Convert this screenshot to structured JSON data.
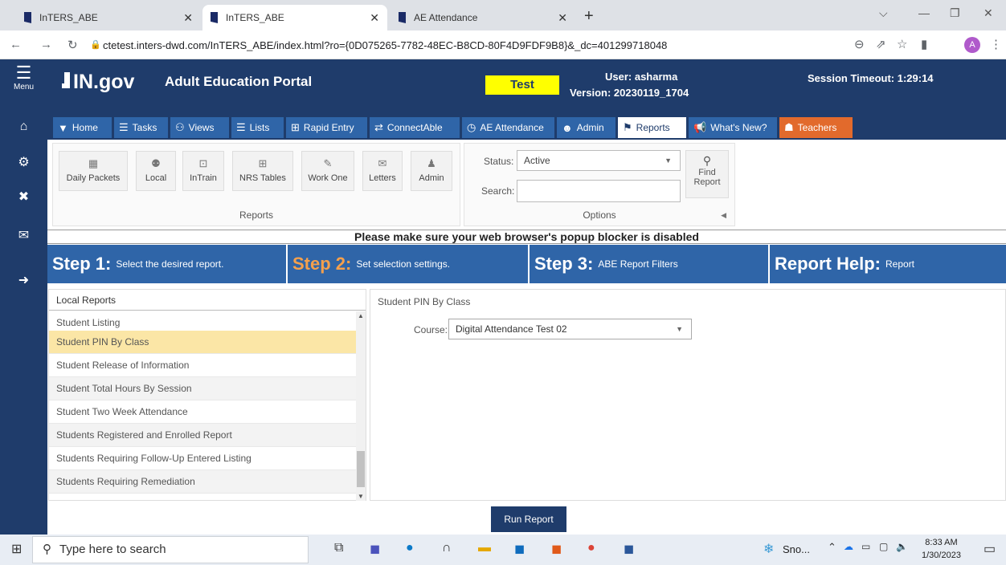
{
  "browser": {
    "tabs": [
      {
        "title": "InTERS_ABE"
      },
      {
        "title": "InTERS_ABE"
      },
      {
        "title": "AE Attendance"
      }
    ],
    "url": "ctetest.inters-dwd.com/InTERS_ABE/index.html?ro={0D075265-7782-48EC-B8CD-80F4D9FDF9B8}&_dc=401299718048",
    "profile_initial": "A"
  },
  "sidebar": {
    "menu_label": "Menu"
  },
  "header": {
    "logo": "IN.gov",
    "portal_title": "Adult Education Portal",
    "env_badge": "Test",
    "user": "User: asharma",
    "version": "Version: 20230119_1704",
    "session": "Session Timeout: 1:29:14"
  },
  "menu": [
    {
      "label": "Home",
      "icon": "funnel-icon"
    },
    {
      "label": "Tasks",
      "icon": "checklist-icon"
    },
    {
      "label": "Views",
      "icon": "binoculars-icon"
    },
    {
      "label": "Lists",
      "icon": "list-icon"
    },
    {
      "label": "Rapid Entry",
      "icon": "table-icon"
    },
    {
      "label": "ConnectAble",
      "icon": "exchange-icon"
    },
    {
      "label": "AE Attendance",
      "icon": "clock-icon"
    },
    {
      "label": "Admin",
      "icon": "users-icon"
    },
    {
      "label": "Reports",
      "icon": "flag-icon"
    },
    {
      "label": "What's New?",
      "icon": "megaphone-icon"
    },
    {
      "label": "Teachers",
      "icon": "teacher-icon"
    }
  ],
  "ribbon": {
    "reports_buttons": [
      {
        "label": "Daily Packets",
        "icon": "calendar-icon"
      },
      {
        "label": "Local",
        "icon": "group-icon"
      },
      {
        "label": "InTrain",
        "icon": "presentation-icon"
      },
      {
        "label": "NRS Tables",
        "icon": "table-icon"
      },
      {
        "label": "Work One",
        "icon": "edit-icon"
      },
      {
        "label": "Letters",
        "icon": "envelope-icon"
      },
      {
        "label": "Admin",
        "icon": "admin-icon"
      }
    ],
    "reports_group_title": "Reports",
    "status_label": "Status:",
    "status_value": "Active",
    "search_label": "Search:",
    "search_value": "",
    "find_report": "Find Report",
    "options_title": "Options"
  },
  "popup_notice": "Please make sure your web browser's popup blocker is disabled",
  "steps": [
    {
      "big": "Step 1:",
      "small": "Select the desired report."
    },
    {
      "big": "Step 2:",
      "small": "Set selection settings."
    },
    {
      "big": "Step 3:",
      "small": "ABE Report Filters"
    },
    {
      "big": "Report Help:",
      "small": "Report"
    }
  ],
  "reports_list": {
    "header": "Local Reports",
    "items": [
      "Student Listing",
      "Student PIN By Class",
      "Student Release of Information",
      "Student Total Hours By Session",
      "Student Two Week Attendance",
      "Students Registered and Enrolled Report",
      "Students Requiring Follow-Up Entered Listing",
      "Students Requiring Remediation"
    ],
    "selected": "Student PIN By Class"
  },
  "settings": {
    "title": "Student PIN By Class",
    "course_label": "Course:",
    "course_value": "Digital Attendance Test 02"
  },
  "run_button": "Run Report",
  "taskbar": {
    "search_placeholder": "Type here to search",
    "weather": "Sno...",
    "time": "8:33 AM",
    "date": "1/30/2023"
  }
}
